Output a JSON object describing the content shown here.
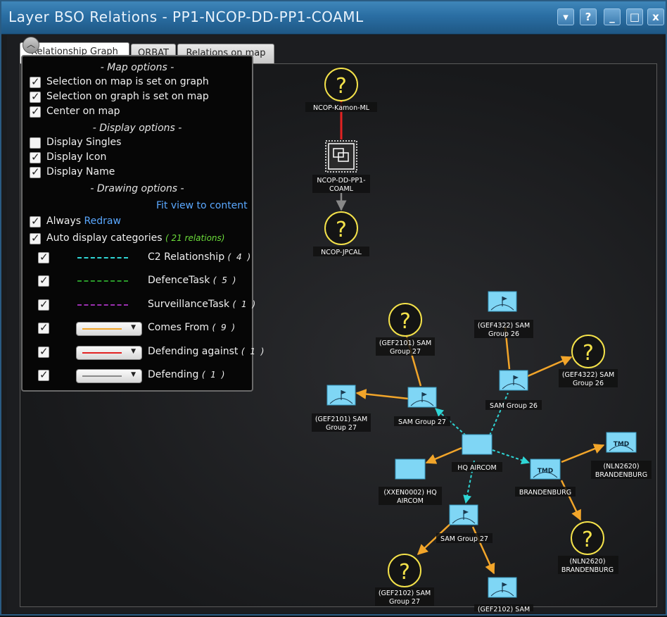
{
  "window": {
    "title": "Layer BSO Relations - PP1-NCOP-DD-PP1-COAML",
    "buttons": {
      "menu": "▾",
      "help": "?",
      "minimize": "_",
      "maximize": "□",
      "close": "x"
    }
  },
  "tabs": [
    {
      "label": "Relationship Graph",
      "active": true
    },
    {
      "label": "ORBAT",
      "active": false
    },
    {
      "label": "Relations on map",
      "active": false
    }
  ],
  "options": {
    "map_header": "- Map options -",
    "selection_on_map": {
      "label": "Selection on map is set on graph",
      "checked": true
    },
    "selection_on_graph": {
      "label": "Selection on graph is set on map",
      "checked": true
    },
    "center_on_map": {
      "label": "Center on map",
      "checked": true
    },
    "display_header": "- Display options -",
    "display_singles": {
      "label": "Display Singles",
      "checked": false
    },
    "display_icon": {
      "label": "Display Icon",
      "checked": true
    },
    "display_name": {
      "label": "Display Name",
      "checked": true
    },
    "drawing_header": "- Drawing options -",
    "fit_view": "Fit view to content",
    "always": {
      "label": "Always",
      "link": "Redraw",
      "checked": true
    },
    "auto_display": {
      "label": "Auto display categories",
      "count": "( 21 relations)",
      "checked": true
    },
    "categories": [
      {
        "label": "C2 Relationship",
        "count": "( 4 )",
        "color": "#2fd6d6",
        "style": "dashed",
        "checked": true
      },
      {
        "label": "DefenceTask",
        "count": "( 5 )",
        "color": "#2a9a2a",
        "style": "dashed",
        "checked": true
      },
      {
        "label": "SurveillanceTask",
        "count": "( 1 )",
        "color": "#9b2fb0",
        "style": "dashed",
        "checked": true
      },
      {
        "label": "Comes From",
        "count": "( 9 )",
        "color": "#f2a52a",
        "style": "select",
        "checked": true
      },
      {
        "label": "Defending against",
        "count": "( 1 )",
        "color": "#e32222",
        "style": "select",
        "checked": true
      },
      {
        "label": "Defending",
        "count": "( 1 )",
        "color": "#8a8a8a",
        "style": "select",
        "checked": true
      }
    ]
  },
  "graph": {
    "colors": {
      "comes_from": "#f2a52a",
      "defending_against": "#e32222",
      "defending": "#888888",
      "c2": "#2fd6d6",
      "unknown": "#f4e24a",
      "friendly": "#7fd6f5"
    },
    "nodes": {
      "ncop_kamon": {
        "label": "NCOP-Kamon-ML",
        "icon": "?"
      },
      "ncop_dd": {
        "label1": "NCOP-DD-PP1-",
        "label2": "COAML"
      },
      "ncop_jpcal": {
        "label": "NCOP-JPCAL",
        "icon": "?"
      },
      "gef2101_unknown": {
        "label1": "(GEF2101) SAM",
        "label2": "Group 27",
        "icon": "?"
      },
      "gef2101_friend": {
        "label1": "(GEF2101) SAM",
        "label2": "Group 27"
      },
      "sam27_top": {
        "label": "SAM Group 27"
      },
      "gef4322_friend": {
        "label1": "(GEF4322) SAM",
        "label2": "Group 26"
      },
      "gef4322_unknown": {
        "label1": "(GEF4322) SAM",
        "label2": "Group 26",
        "icon": "?"
      },
      "sam26": {
        "label": "SAM Group 26"
      },
      "hq_aircom": {
        "label": "HQ AIRCOM"
      },
      "xxen0002": {
        "label1": "(XXEN0002) HQ",
        "label2": "AIRCOM"
      },
      "brandenburg": {
        "label": "BRANDENBURG",
        "tag": "TMD"
      },
      "nln2620_friend": {
        "label1": "(NLN2620)",
        "label2": "BRANDENBURG",
        "tag": "TMD"
      },
      "nln2620_unknown": {
        "label1": "(NLN2620)",
        "label2": "BRANDENBURG",
        "icon": "?"
      },
      "sam27_bottom": {
        "label": "SAM Group 27"
      },
      "gef2102_unknown": {
        "label1": "(GEF2102) SAM",
        "label2": "Group 27",
        "icon": "?"
      },
      "gef2102_friend": {
        "label": "(GEF2102) SAM"
      }
    }
  }
}
